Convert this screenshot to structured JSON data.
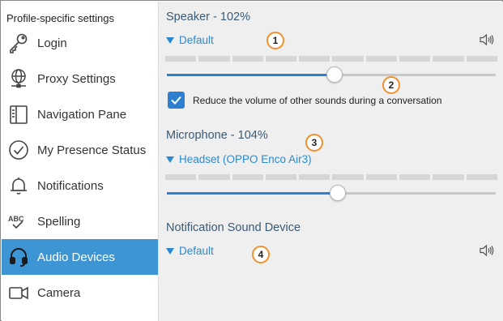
{
  "sidebar": {
    "header": "Profile-specific settings",
    "items": [
      {
        "label": "Login",
        "icon": "key-icon"
      },
      {
        "label": "Proxy Settings",
        "icon": "globe-network-icon"
      },
      {
        "label": "Navigation Pane",
        "icon": "panel-icon"
      },
      {
        "label": "My Presence Status",
        "icon": "check-circle-icon"
      },
      {
        "label": "Notifications",
        "icon": "bell-icon"
      },
      {
        "label": "Spelling",
        "icon": "spelling-icon"
      },
      {
        "label": "Audio Devices",
        "icon": "headset-icon",
        "active": true
      },
      {
        "label": "Camera",
        "icon": "camera-icon"
      }
    ],
    "spelling_icon_text": "ABC"
  },
  "speaker": {
    "title": "Speaker - 102%",
    "device": "Default",
    "volume_fraction": 0.51,
    "checkbox_checked": true,
    "checkbox_label": "Reduce the volume of other sounds during a conversation"
  },
  "microphone": {
    "title": "Microphone - 104%",
    "device": "Headset (OPPO Enco Air3)",
    "volume_fraction": 0.52
  },
  "notification": {
    "title": "Notification Sound Device",
    "device": "Default"
  },
  "badges": [
    "1",
    "2",
    "3",
    "4"
  ],
  "colors": {
    "accent": "#2f7fd0",
    "active_nav": "#3d95d3",
    "badge_border": "#f0912d"
  }
}
